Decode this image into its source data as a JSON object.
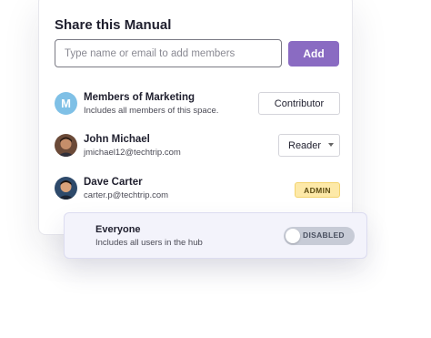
{
  "dialog": {
    "title": "Share this Manual",
    "search": {
      "placeholder": "Type name or email to add members",
      "value": ""
    },
    "add_label": "Add"
  },
  "members": [
    {
      "avatar_letter": "M",
      "name": "Members of Marketing",
      "detail": "Includes all members of this space.",
      "role": "Contributor"
    },
    {
      "name": "John Michael",
      "detail": "jmichael12@techtrip.com",
      "role": "Reader"
    },
    {
      "name": "Dave Carter",
      "detail": "carter.p@techtrip.com",
      "role": "ADMIN"
    }
  ],
  "everyone": {
    "title": "Everyone",
    "detail": "Includes all users in the hub",
    "toggle_label": "DISABLED",
    "toggle_on": false
  },
  "colors": {
    "accent": "#8a6bc2",
    "group_avatar": "#7fc0e6",
    "admin_badge": "#fde9a8",
    "toggle_track": "#c7cbd6"
  }
}
